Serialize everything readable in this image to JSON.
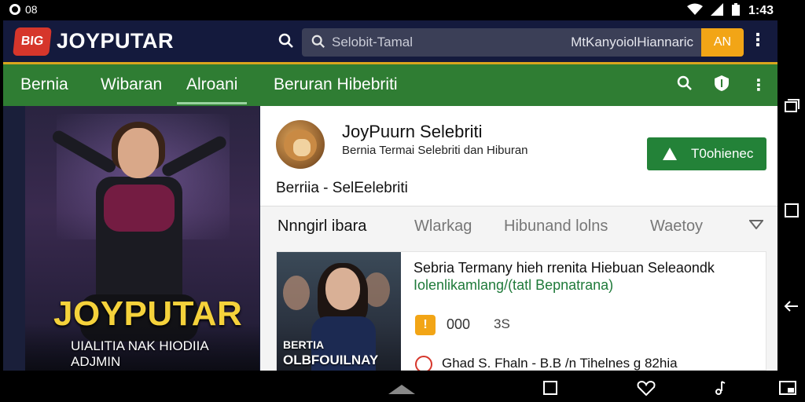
{
  "status_bar": {
    "left_text": "08",
    "time": "1:43"
  },
  "header": {
    "logo_text": "BIG",
    "brand": "JOYPUTAR",
    "search_placeholder": "Selobit-Tamal",
    "search_extra": "MtKanyoiolHiannaric",
    "search_button": "AN"
  },
  "nav": {
    "items": [
      "Bernia",
      "Wibaran",
      "Alroani",
      "Beruran Hibebriti"
    ],
    "active_index": 2
  },
  "hero": {
    "title": "JOYPUTAR",
    "sub1": "UIALITIA NAK HIODIIA",
    "sub2": "ADJMIN"
  },
  "profile": {
    "name": "JoyPuurn Selebriti",
    "subtitle": "Bernia Termai Selebriti dan Hiburan",
    "button_label": "T0ohienec",
    "category": "Berriia - SelEelebriti"
  },
  "tabs": [
    "Nnngirl ibara",
    "Wlarkag",
    "Hibunand lolns",
    "Waetoy"
  ],
  "story": {
    "thumb_tag1": "BERTIA",
    "thumb_tag2": "OLBFOUILNAY",
    "title": "Sebria Termany hieh rrenita Hiebuan Seleaondk",
    "link": "Iolenlikamlang/(tatl Bepnatrana)",
    "stat_icon": "!",
    "count": "000",
    "count2": "3S",
    "author": "Ghad S. Fhaln - B.B /n Tihelnes g 82hia"
  },
  "colors": {
    "header_bg": "#141a3d",
    "nav_bg": "#2f7d33",
    "accent": "#f2a516",
    "button_green": "#238238"
  }
}
